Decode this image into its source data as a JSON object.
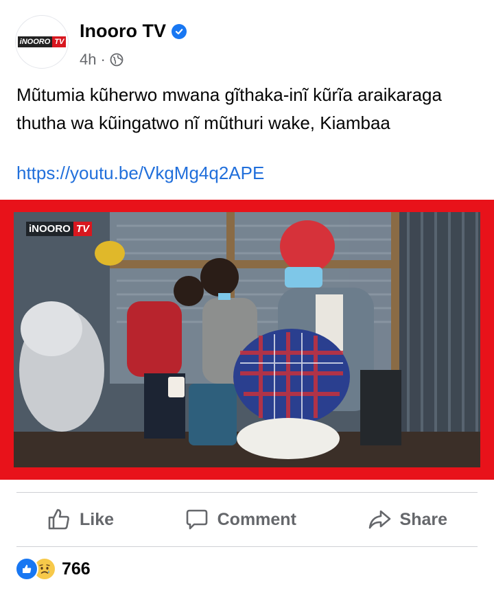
{
  "page": {
    "name": "Inooro TV",
    "verified": true,
    "avatar_logo": [
      "iNOORO",
      "TV"
    ],
    "time": "4h",
    "separator": "·",
    "audience_icon": "globe-icon"
  },
  "post": {
    "text": "Mũtumia kũherwo mwana gĩthaka-inĩ kũrĩa araikaraga thutha wa kũingatwo nĩ mũthuri wake, Kiambaa",
    "link": "https://youtu.be/VkgMg4q2APE"
  },
  "media": {
    "logo": [
      "iNOORO",
      "TV"
    ],
    "frame_color": "#e8121a"
  },
  "actions": [
    {
      "label": "Like",
      "icon": "thumbs-up-icon"
    },
    {
      "label": "Comment",
      "icon": "comment-bubble-icon"
    },
    {
      "label": "Share",
      "icon": "share-arrow-icon"
    }
  ],
  "reactions": {
    "icons": [
      "like-reaction-icon",
      "sad-reaction-icon"
    ],
    "count": "766"
  },
  "colors": {
    "link": "#216fdb",
    "verified": "#1877f2",
    "secondary_text": "#65676b"
  }
}
